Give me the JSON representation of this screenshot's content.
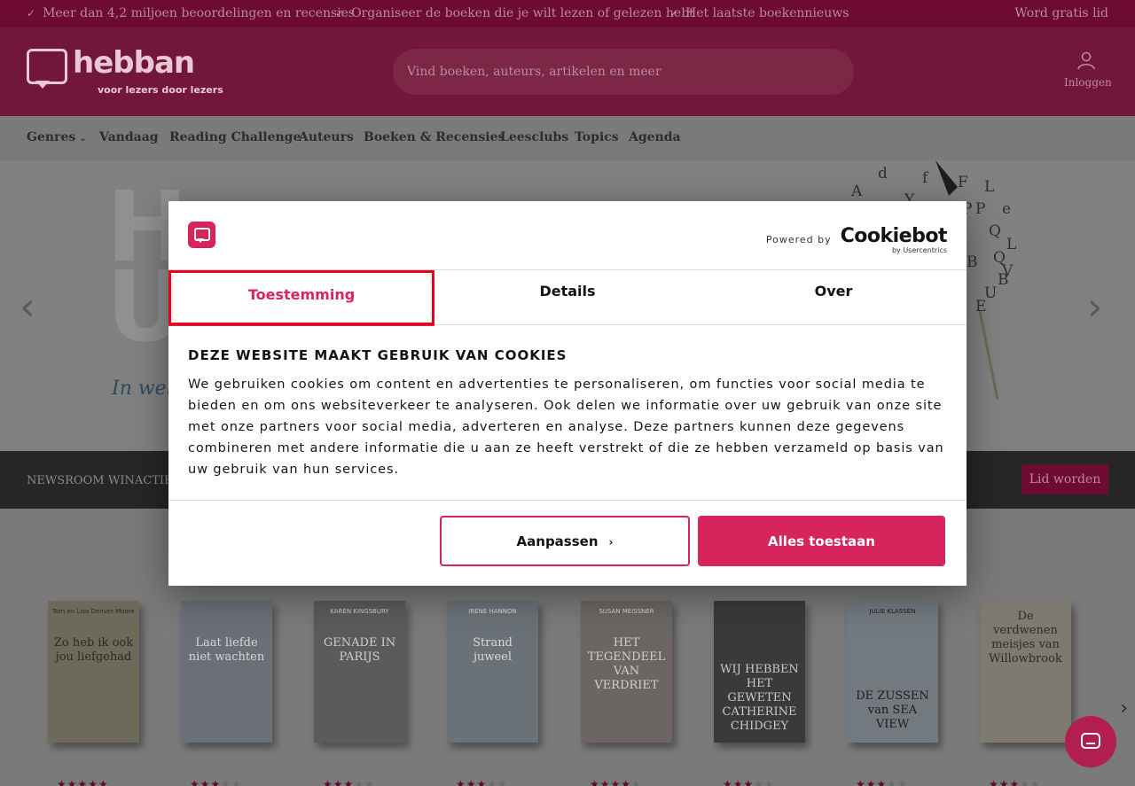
{
  "topbar": {
    "usps": [
      "Meer dan 4,2 miljoen beoordelingen en recensies",
      "Organiseer de boeken die je wilt lezen of gelezen hebt",
      "Het laatste boekennieuws"
    ],
    "join_label": "Word gratis lid"
  },
  "header": {
    "logo_text": "hebban",
    "logo_tagline": "voor lezers door lezers",
    "search_placeholder": "Vind boeken, auteurs, artikelen en meer",
    "login_label": "Inloggen"
  },
  "nav": {
    "items": [
      "Genres",
      "Vandaag",
      "Reading Challenge",
      "Auteurs",
      "Boeken & Recensies",
      "Leesclubs",
      "Topics",
      "Agenda"
    ]
  },
  "subnav": {
    "items": [
      "NEWSROOM",
      "WINACTIES"
    ],
    "member_button": "Lid worden"
  },
  "books": [
    {
      "author": "Tom en Lisa Denver Moore",
      "title": "Zo heb ik ook jou liefgehad",
      "rating": 5
    },
    {
      "author": "",
      "title": "Laat liefde niet wachten",
      "rating": 3
    },
    {
      "author": "KAREN KINGSBURY",
      "title": "GENADE IN PARIJS",
      "rating": 3
    },
    {
      "author": "IRENE HANNON",
      "title": "Strand juweel",
      "rating": 3
    },
    {
      "author": "SUSAN MEISSNER",
      "title": "HET TEGENDEEL VAN VERDRIET",
      "rating": 4
    },
    {
      "author": "",
      "title": "WIJ HEBBEN HET GEWETEN CATHERINE CHIDGEY",
      "rating": 3
    },
    {
      "author": "JULIE KLASSEN",
      "title": "DE ZUSSEN van SEA VIEW",
      "rating": 3
    },
    {
      "author": "",
      "title": "De verdwenen meisjes van Willowbrook",
      "rating": 3
    }
  ],
  "dialog": {
    "powered_by": "Powered by",
    "brand": "Cookiebot",
    "brand_sub": "by Usercentrics",
    "tabs": [
      "Toestemming",
      "Details",
      "Over"
    ],
    "heading": "DEZE WEBSITE MAAKT GEBRUIK VAN COOKIES",
    "body": "We gebruiken cookies om content en advertenties te personaliseren, om functies voor social media te bieden en om ons websiteverkeer te analyseren. Ook delen we informatie over uw gebruik van onze site met onze partners voor social media, adverteren en analyse. Deze partners kunnen deze gegevens combineren met andere informatie die u aan ze heeft verstrekt of die ze hebben verzameld op basis van uw gebruik van hun services.",
    "customize_label": "Aanpassen",
    "allow_all_label": "Alles toestaan"
  },
  "colors": {
    "accent": "#d6245c",
    "header_bg_dimmed": "#72163a",
    "focus_outline": "#e8001c"
  }
}
